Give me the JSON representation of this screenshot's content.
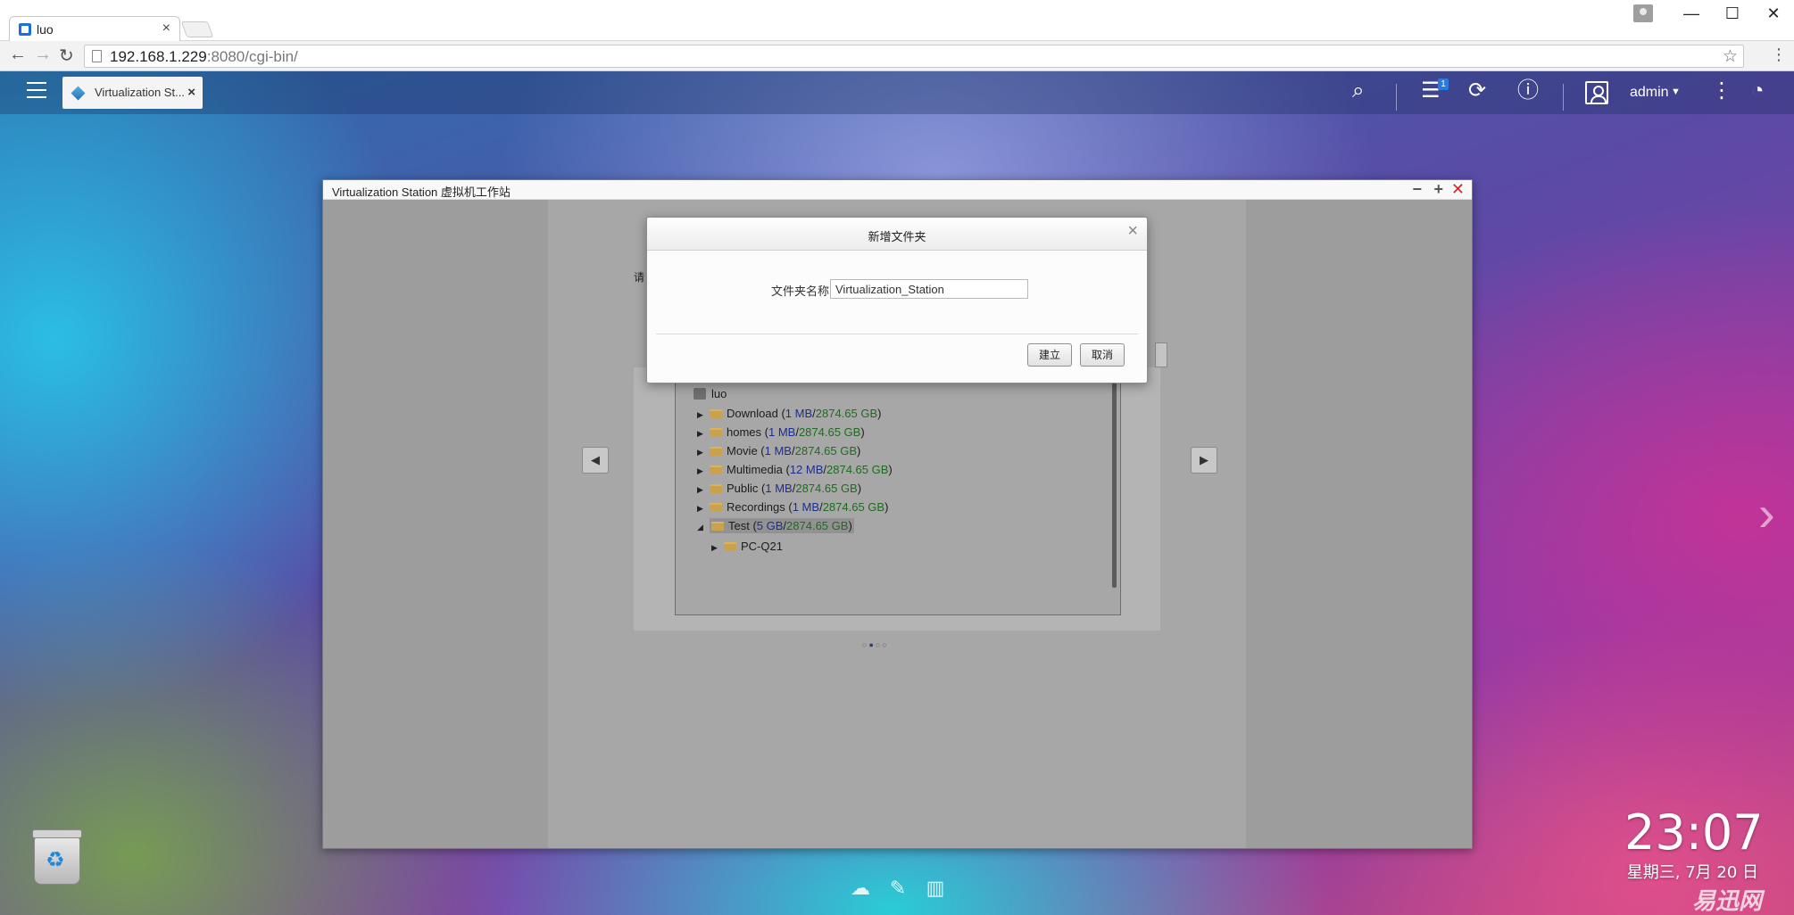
{
  "browser": {
    "tab_title": "luo",
    "url_host": "192.168.1.229",
    "url_path": ":8080/cgi-bin/"
  },
  "qts": {
    "app_tab_title": "Virtualization St...",
    "notification_count": "1",
    "user": "admin"
  },
  "window": {
    "title": "Virtualization Station 虚拟机工作站"
  },
  "wizard": {
    "label_fragment": "请",
    "tree": [
      {
        "name": "luo",
        "type": "nas"
      },
      {
        "name": "Download",
        "used": "1 MB",
        "total": "2874.65 GB"
      },
      {
        "name": "homes",
        "used": "1 MB",
        "total": "2874.65 GB"
      },
      {
        "name": "Movie",
        "used": "1 MB",
        "total": "2874.65 GB"
      },
      {
        "name": "Multimedia",
        "used": "12 MB",
        "total": "2874.65 GB"
      },
      {
        "name": "Public",
        "used": "1 MB",
        "total": "2874.65 GB"
      },
      {
        "name": "Recordings",
        "used": "1 MB",
        "total": "2874.65 GB"
      },
      {
        "name": "Test",
        "used": "5 GB",
        "total": "2874.65 GB",
        "expanded": true,
        "selected": true
      },
      {
        "name": "PC-Q21",
        "child": true
      }
    ]
  },
  "dialog": {
    "title": "新增文件夹",
    "field_label": "文件夹名称",
    "field_value": "Virtualization_Station",
    "create_button": "建立",
    "cancel_button": "取消"
  },
  "desktop": {
    "time": "23:07",
    "date": "星期三, 7月 20 日",
    "watermark": "易迅网"
  }
}
